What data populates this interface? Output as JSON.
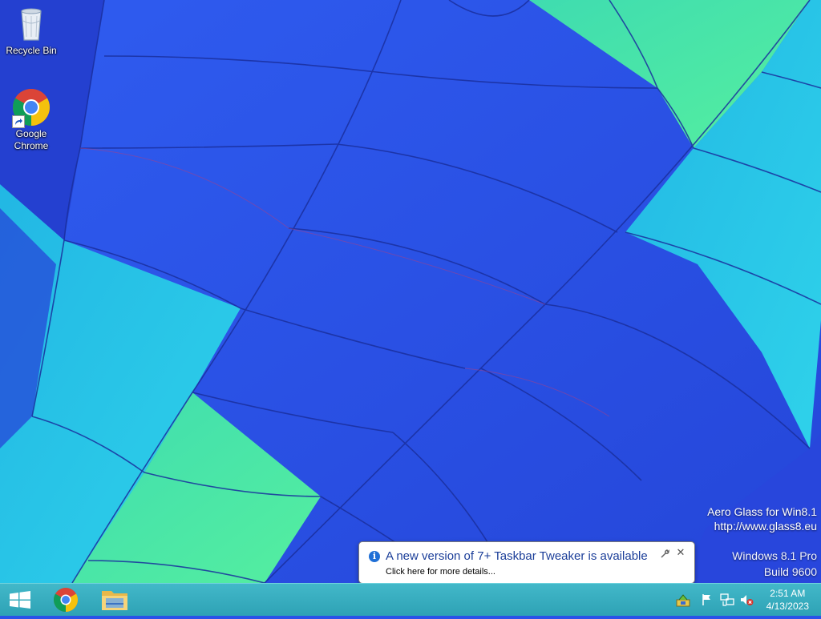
{
  "desktop": {
    "icons": [
      {
        "label": "Recycle Bin",
        "icon": "recycle-bin-icon"
      },
      {
        "label": "Google Chrome",
        "icon": "chrome-icon"
      }
    ],
    "watermark": {
      "line1": "Aero Glass for Win8.1",
      "line2": "http://www.glass8.eu",
      "line3": "Windows 8.1 Pro",
      "line4": "Build 9600"
    }
  },
  "notification": {
    "title": "A new version of 7+ Taskbar Tweaker is available",
    "subtitle": "Click here for more details...",
    "info_icon": "i",
    "close": "✕"
  },
  "taskbar": {
    "pinned": [
      {
        "name": "start",
        "icon": "windows-logo-icon"
      },
      {
        "name": "chrome",
        "icon": "chrome-icon"
      },
      {
        "name": "file-explorer",
        "icon": "folder-icon"
      }
    ],
    "tray": [
      {
        "icon": "taskbar-tweaker-icon"
      },
      {
        "icon": "action-center-flag-icon"
      },
      {
        "icon": "network-icon"
      },
      {
        "icon": "volume-muted-icon"
      }
    ],
    "clock": {
      "time": "2:51 AM",
      "date": "4/13/2023"
    }
  },
  "colors": {
    "taskbar": "#36aabd",
    "notification_title": "#1b3e99",
    "wallpaper_blue": "#2a52e8",
    "wallpaper_cyan": "#27c9e8",
    "wallpaper_green": "#4ce8a6"
  }
}
